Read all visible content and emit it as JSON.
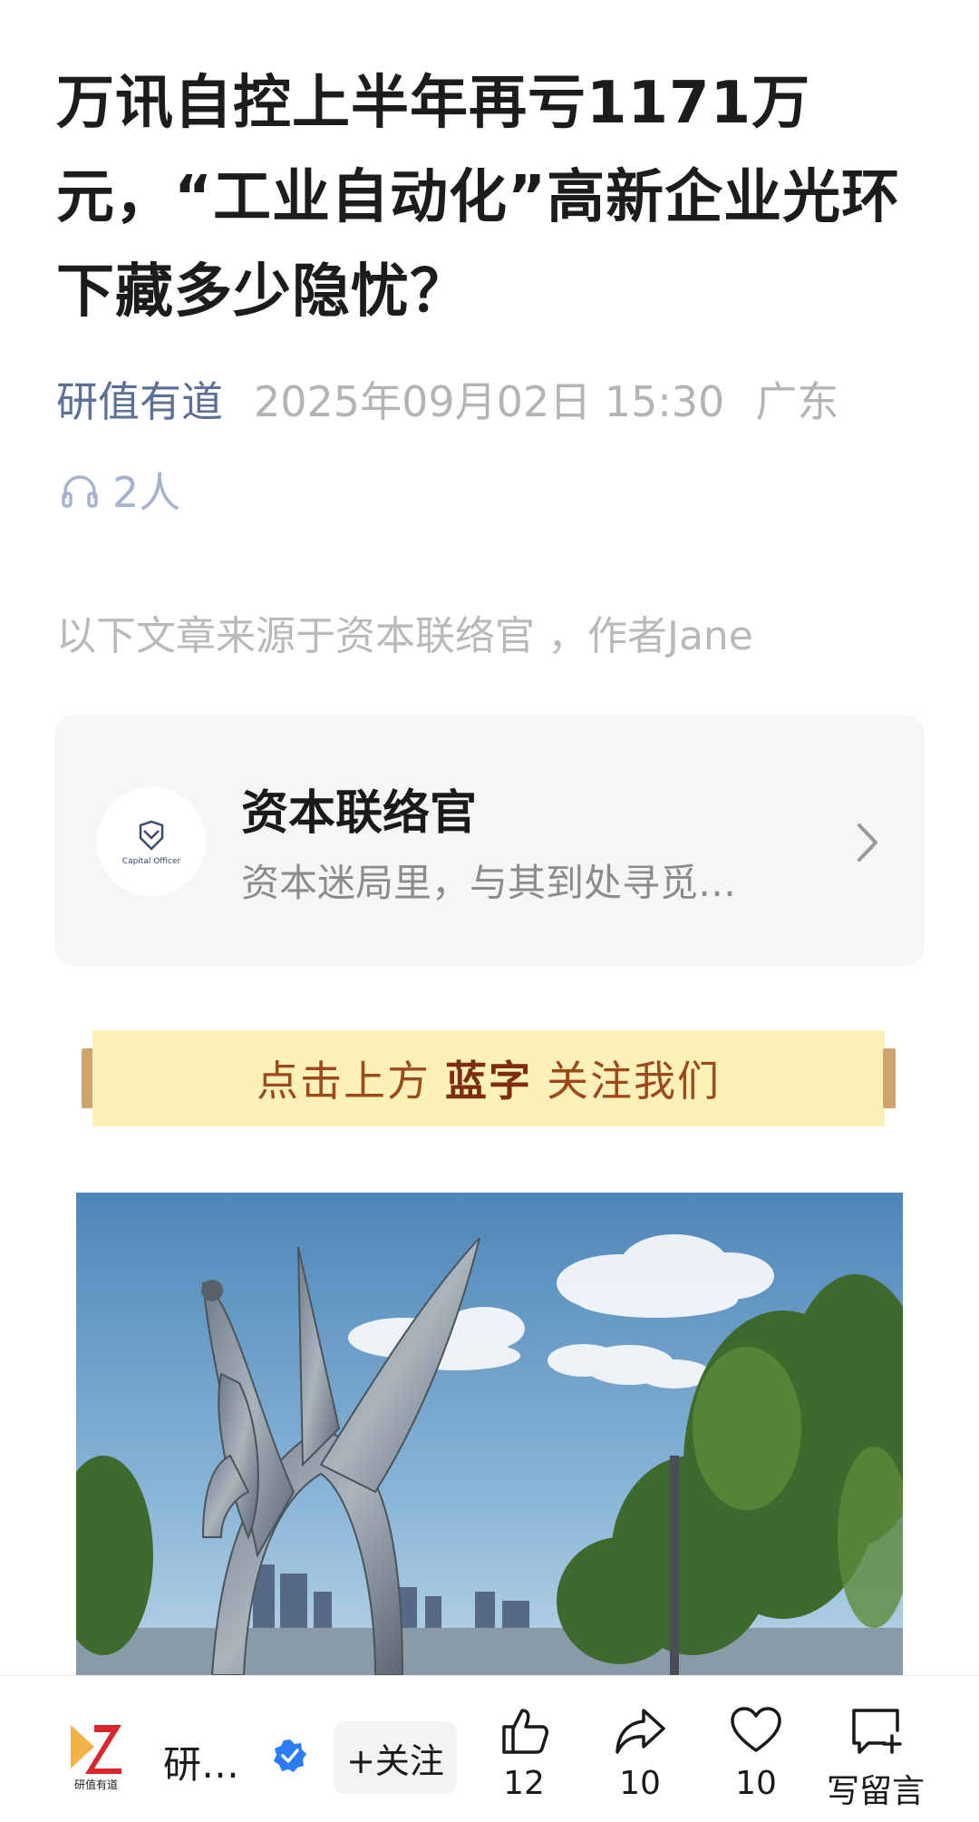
{
  "article": {
    "title": "万讯自控上半年再亏1171万元，“工业自动化”高新企业光环下藏多少隐忧？",
    "author": "研值有道",
    "datetime": "2025年09月02日 15:30",
    "location": "广东",
    "listeners": "2人",
    "source_note": "以下文章来源于资本联络官 ，作者Jane"
  },
  "source_card": {
    "name": "资本联络官",
    "description": "资本迷局里，与其到处寻觅…",
    "logo_text": "Capital Officer"
  },
  "banner": {
    "prefix": "点击上方",
    "highlight": "蓝字",
    "suffix": "关注我们"
  },
  "bottom_bar": {
    "brand_name": "研…",
    "brand_logo_text": "研值有道",
    "follow_label": "+关注",
    "like_count": "12",
    "share_count": "10",
    "favorite_count": "10",
    "comment_label": "写留言"
  },
  "colors": {
    "author": "#5c6f95",
    "banner_bg": "#fdf0b8",
    "banner_text": "#9b4a1c",
    "verify_badge": "#2b7cf6"
  }
}
